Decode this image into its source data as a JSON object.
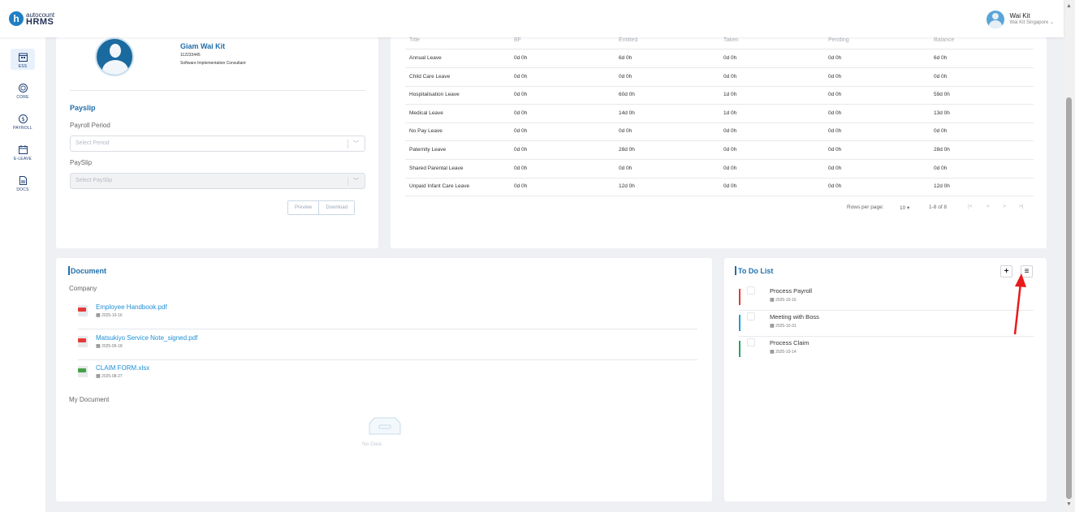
{
  "app": {
    "brand_small": "autocount",
    "brand_main": "HRMS",
    "brand_mark": "h"
  },
  "user": {
    "name": "Wai Kit",
    "subtitle": "Wai Kit Singapore ⌄"
  },
  "sidebar": {
    "items": [
      {
        "label": "ESS",
        "icon": "calendar-grid-icon",
        "active": true
      },
      {
        "label": "CORE",
        "icon": "cube-icon",
        "active": false
      },
      {
        "label": "PAYROLL",
        "icon": "dollar-circle-icon",
        "active": false
      },
      {
        "label": "E-LEAVE",
        "icon": "calendar-icon",
        "active": false
      },
      {
        "label": "DOCS",
        "icon": "document-icon",
        "active": false
      }
    ]
  },
  "profile": {
    "name": "Giam Wai Kit",
    "employee_id": "112233445",
    "job_title": "Software Implementation Consultant"
  },
  "payslip": {
    "title": "Payslip",
    "period_label": "Payroll Period",
    "period_placeholder": "Select Period",
    "payslip_label": "PaySlip",
    "payslip_placeholder": "Select PaySlip",
    "preview_label": "Preview",
    "download_label": "Download"
  },
  "leave_table": {
    "headers": [
      "Title",
      "BF",
      "Entitled",
      "Taken",
      "Pending",
      "Balance"
    ],
    "rows": [
      [
        "Annual Leave",
        "0d 0h",
        "6d 0h",
        "0d 0h",
        "0d 0h",
        "6d 0h"
      ],
      [
        "Child Care Leave",
        "0d 0h",
        "0d 0h",
        "0d 0h",
        "0d 0h",
        "0d 0h"
      ],
      [
        "Hospitalisation Leave",
        "0d 0h",
        "60d 0h",
        "1d 0h",
        "0d 0h",
        "59d 0h"
      ],
      [
        "Medical Leave",
        "0d 0h",
        "14d 0h",
        "1d 0h",
        "0d 0h",
        "13d 0h"
      ],
      [
        "No Pay Leave",
        "0d 0h",
        "0d 0h",
        "0d 0h",
        "0d 0h",
        "0d 0h"
      ],
      [
        "Paternity Leave",
        "0d 0h",
        "28d 0h",
        "0d 0h",
        "0d 0h",
        "28d 0h"
      ],
      [
        "Shared Parental Leave",
        "0d 0h",
        "0d 0h",
        "0d 0h",
        "0d 0h",
        "0d 0h"
      ],
      [
        "Unpaid Infant Care Leave",
        "0d 0h",
        "12d 0h",
        "0d 0h",
        "0d 0h",
        "12d 0h"
      ]
    ],
    "rows_per_page_label": "Rows per page:",
    "rows_per_page_value": "10",
    "range_text": "1-8 of 8"
  },
  "document": {
    "title": "Document",
    "company_label": "Company",
    "files": [
      {
        "name": "Employee Handbook.pdf",
        "date": "2025-10-16",
        "type": "pdf",
        "color": "#e53935"
      },
      {
        "name": "Matsukiyo Service Note_signed.pdf",
        "date": "2025-09-18",
        "type": "pdf",
        "color": "#e53935"
      },
      {
        "name": "CLAIM FORM.xlsx",
        "date": "2025-08-27",
        "type": "xlsx",
        "color": "#43a047"
      }
    ],
    "my_document_label": "My Document",
    "empty_text": "No Data"
  },
  "todo": {
    "title": "To Do List",
    "add_label": "+",
    "list_label": "≡",
    "items": [
      {
        "text": "Process Payroll",
        "date": "2025-10-16",
        "color": "#e53935"
      },
      {
        "text": "Meeting with Boss",
        "date": "2025-10-31",
        "color": "#1f9fd6"
      },
      {
        "text": "Process Claim",
        "date": "2025-10-14",
        "color": "#26a269"
      }
    ]
  },
  "colors": {
    "accent": "#1f6fab",
    "link": "#1f8fd6",
    "annotation_arrow": "#e81b1b"
  }
}
